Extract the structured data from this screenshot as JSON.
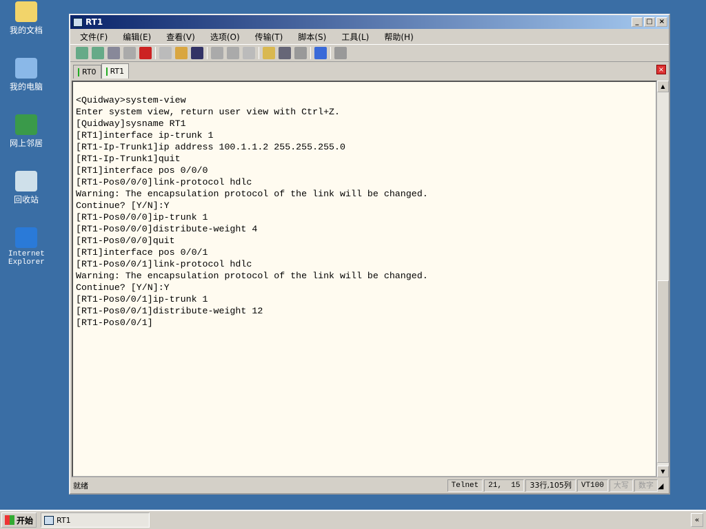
{
  "desktop": [
    {
      "label": "我的文档",
      "icon": "folder-icon",
      "color": "#f2d46a"
    },
    {
      "label": "我的电脑",
      "icon": "computer-icon",
      "color": "#8ab8e8"
    },
    {
      "label": "网上邻居",
      "icon": "network-icon",
      "color": "#3a9a4a"
    },
    {
      "label": "回收站",
      "icon": "recycle-bin-icon",
      "color": "#cfe0ea"
    },
    {
      "label": "Internet Explorer",
      "icon": "ie-icon",
      "color": "#2a7ad8"
    }
  ],
  "window": {
    "title": "RT1",
    "min": "_",
    "max": "□",
    "close": "×"
  },
  "menu": [
    "文件(F)",
    "编辑(E)",
    "查看(V)",
    "选项(O)",
    "传输(T)",
    "脚本(S)",
    "工具(L)",
    "帮助(H)"
  ],
  "tabs": [
    "RT0",
    "RT1"
  ],
  "tab_close": "×",
  "terminal": [
    "<Quidway>system-view",
    "Enter system view, return user view with Ctrl+Z.",
    "[Quidway]sysname RT1",
    "[RT1]interface ip-trunk 1",
    "[RT1-Ip-Trunk1]ip address 100.1.1.2 255.255.255.0",
    "[RT1-Ip-Trunk1]quit",
    "[RT1]interface pos 0/0/0",
    "[RT1-Pos0/0/0]link-protocol hdlc",
    "Warning: The encapsulation protocol of the link will be changed.",
    "Continue? [Y/N]:Y",
    "[RT1-Pos0/0/0]ip-trunk 1",
    "[RT1-Pos0/0/0]distribute-weight 4",
    "[RT1-Pos0/0/0]quit",
    "[RT1]interface pos 0/0/1",
    "[RT1-Pos0/0/1]link-protocol hdlc",
    "Warning: The encapsulation protocol of the link will be changed.",
    "Continue? [Y/N]:Y",
    "[RT1-Pos0/0/1]ip-trunk 1",
    "[RT1-Pos0/0/1]distribute-weight 12",
    "[RT1-Pos0/0/1]"
  ],
  "status": {
    "ready": "就绪",
    "protocol": "Telnet",
    "cursor": "21,  15",
    "size": "33行,105列",
    "emulation": "VT100",
    "caps": "大写",
    "num": "数字"
  },
  "taskbar": {
    "start": "开始",
    "task": "RT1",
    "tray": "«"
  }
}
